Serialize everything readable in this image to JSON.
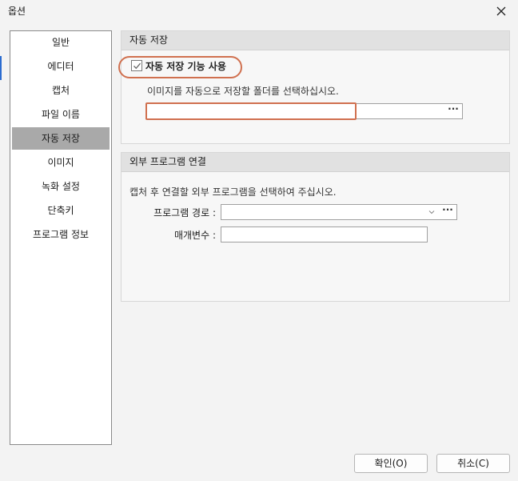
{
  "window": {
    "title": "옵션"
  },
  "sidebar": {
    "items": [
      {
        "label": "일반"
      },
      {
        "label": "에디터"
      },
      {
        "label": "캡처"
      },
      {
        "label": "파일 이름"
      },
      {
        "label": "자동 저장",
        "selected": true
      },
      {
        "label": "이미지"
      },
      {
        "label": "녹화 설정"
      },
      {
        "label": "단축키"
      },
      {
        "label": "프로그램 정보"
      }
    ]
  },
  "autosave": {
    "header": "자동 저장",
    "checkbox_label": "자동 저장 기능 사용",
    "checkbox_checked": true,
    "hint": "이미지를 자동으로 저장할 폴더를 선택하십시오.",
    "folder_value": "",
    "browse_label": "···"
  },
  "external": {
    "header": "외부 프로그램 연결",
    "hint": "캡처 후 연결할 외부 프로그램을 선택하여 주십시오.",
    "program_path_label": "프로그램 경로 :",
    "program_path_value": "",
    "browse_label": "···",
    "params_label": "매개변수 :",
    "params_value": ""
  },
  "buttons": {
    "ok": "확인(O)",
    "cancel": "취소(C)"
  },
  "colors": {
    "highlight": "#d0704f",
    "selected_bg": "#a9a9a9"
  }
}
